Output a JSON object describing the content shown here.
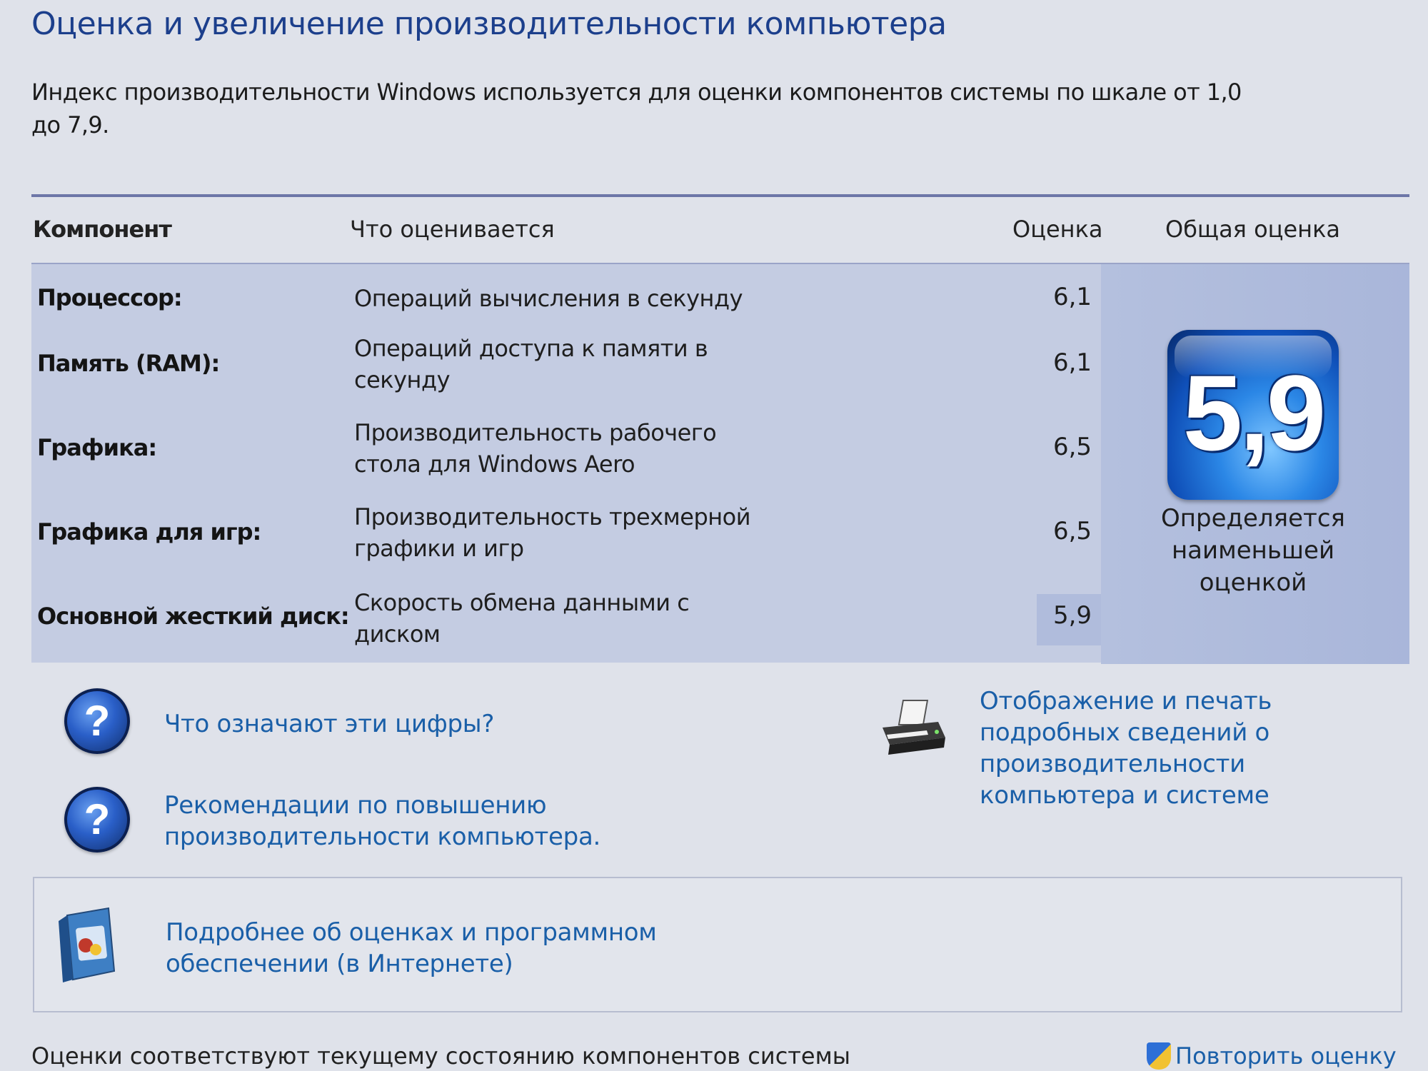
{
  "page": {
    "title": "Оценка и увеличение производительности компьютера",
    "intro": "Индекс производительности Windows используется для оценки компонентов системы по шкале от 1,0 до 7,9."
  },
  "table": {
    "headers": {
      "component": "Компонент",
      "what": "Что оценивается",
      "score": "Оценка",
      "overall": "Общая оценка"
    },
    "rows": [
      {
        "name": "Процессор:",
        "what": "Операций вычисления в секунду",
        "score": "6,1"
      },
      {
        "name": "Память (RAM):",
        "what": "Операций доступа к памяти в секунду",
        "score": "6,1"
      },
      {
        "name": "Графика:",
        "what": "Производительность рабочего стола для Windows Aero",
        "score": "6,5"
      },
      {
        "name": "Графика для игр:",
        "what": "Производительность трехмерной графики и игр",
        "score": "6,5"
      },
      {
        "name": "Основной жесткий диск:",
        "what": "Скорость обмена данными с диском",
        "score": "5,9"
      }
    ],
    "overall": {
      "value": "5,9",
      "caption": "Определяется наименьшей оценкой"
    }
  },
  "links": {
    "what_numbers_mean": "Что означают эти цифры?",
    "recommendations": "Рекомендации по повышению производительности компьютера.",
    "print_details": "Отображение и печать подробных сведений о производительности компьютера и системе",
    "more_online": "Подробнее об оценках и программном обеспечении (в Интернете)"
  },
  "footer": {
    "status": "Оценки соответствуют текущему состоянию компонентов системы",
    "rerun": "Повторить оценку"
  },
  "icons": {
    "help": "help-icon",
    "printer": "printer-icon",
    "book": "book-icon",
    "shield": "shield-icon"
  },
  "colors": {
    "title": "#1c3f8c",
    "link": "#1a5fa8",
    "table_bg": "#c4cce2",
    "badge": "#0f4fb8"
  }
}
